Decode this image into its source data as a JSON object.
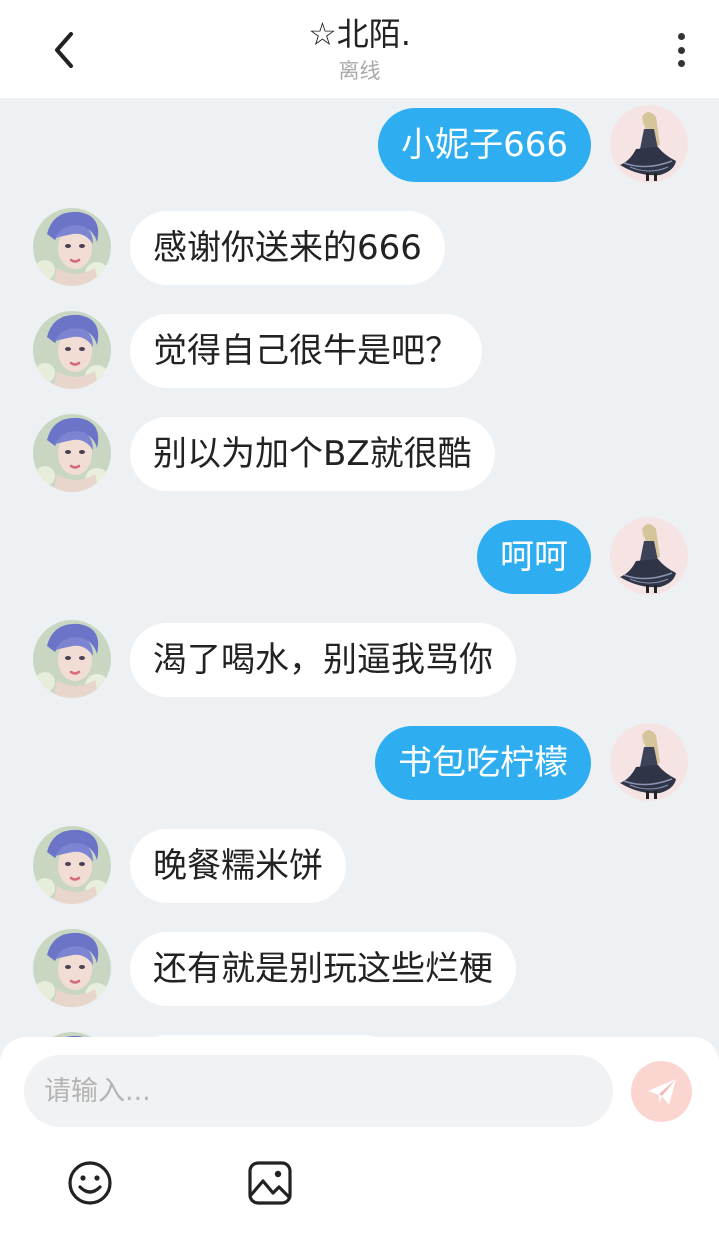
{
  "header": {
    "back_icon": "chevron-left-icon",
    "title": "☆北陌.",
    "status": "离线",
    "more_icon": "more-vertical-icon"
  },
  "messages": [
    {
      "direction": "out",
      "text": "小妮子666"
    },
    {
      "direction": "in",
      "text": "感谢你送来的666"
    },
    {
      "direction": "in",
      "text": "觉得自己很牛是吧？"
    },
    {
      "direction": "in",
      "text": "别以为加个BZ就很酷"
    },
    {
      "direction": "out",
      "text": "呵呵"
    },
    {
      "direction": "in",
      "text": "渴了喝水，别逼我骂你"
    },
    {
      "direction": "out",
      "text": "书包吃柠檬"
    },
    {
      "direction": "in",
      "text": "晚餐糯米饼"
    },
    {
      "direction": "in",
      "text": "还有就是别玩这些烂梗"
    },
    {
      "direction": "in",
      "text": ""
    }
  ],
  "composer": {
    "placeholder": "请输入...",
    "value": "",
    "send_icon": "send-icon",
    "emoji_icon": "emoji-icon",
    "image_icon": "image-icon"
  },
  "colors": {
    "outgoing_bubble": "#2eaef0",
    "incoming_bubble": "#ffffff",
    "chat_background": "#eef1f3",
    "send_button": "#fbd6d1"
  }
}
